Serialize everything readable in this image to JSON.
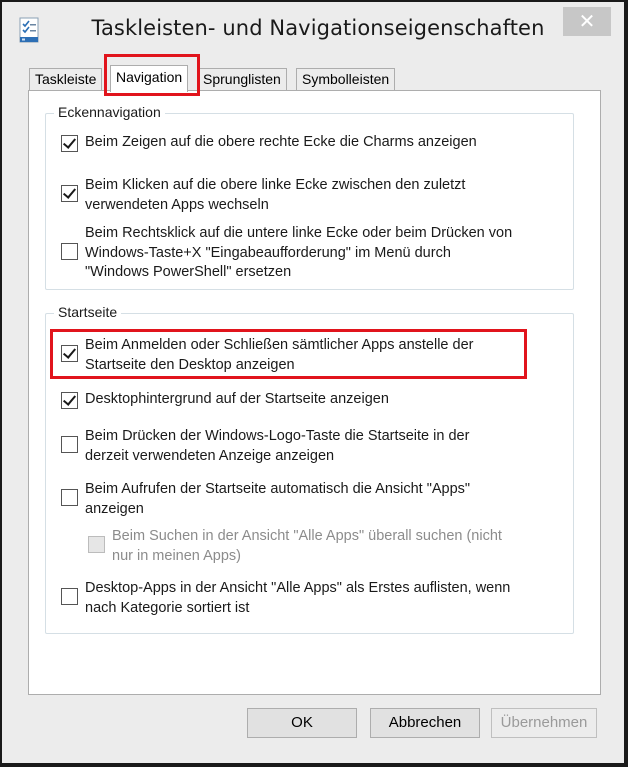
{
  "window": {
    "title": "Taskleisten- und Navigationseigenschaften",
    "close_symbol": "✕"
  },
  "tabs": [
    {
      "label": "Taskleiste",
      "active": false
    },
    {
      "label": "Navigation",
      "active": true
    },
    {
      "label": "Sprunglisten",
      "active": false
    },
    {
      "label": "Symbolleisten",
      "active": false
    }
  ],
  "groups": {
    "corner": {
      "title": "Eckennavigation",
      "items": [
        {
          "lines": [
            "Beim Zeigen auf die obere rechte Ecke die Charms anzeigen"
          ],
          "checked": true,
          "disabled": false
        },
        {
          "lines": [
            "Beim Klicken auf die obere linke Ecke zwischen den zuletzt",
            "verwendeten Apps wechseln"
          ],
          "checked": true,
          "disabled": false
        },
        {
          "lines": [
            "Beim Rechtsklick auf die untere linke Ecke oder beim Drücken von",
            "Windows-Taste+X \"Eingabeaufforderung\" im Menü durch",
            "\"Windows PowerShell\" ersetzen"
          ],
          "checked": false,
          "disabled": false
        }
      ]
    },
    "start": {
      "title": "Startseite",
      "items": [
        {
          "lines": [
            "Beim Anmelden oder Schließen sämtlicher Apps anstelle der",
            "Startseite den Desktop anzeigen"
          ],
          "checked": true,
          "disabled": false
        },
        {
          "lines": [
            "Desktophintergrund auf der Startseite anzeigen"
          ],
          "checked": true,
          "disabled": false
        },
        {
          "lines": [
            "Beim Drücken der Windows-Logo-Taste die Startseite in der",
            "derzeit verwendeten Anzeige anzeigen"
          ],
          "checked": false,
          "disabled": false
        },
        {
          "lines": [
            "Beim Aufrufen der Startseite automatisch die Ansicht \"Apps\"",
            "anzeigen"
          ],
          "checked": false,
          "disabled": false
        },
        {
          "lines": [
            "Beim Suchen in der Ansicht \"Alle Apps\" überall suchen (nicht",
            "nur in meinen Apps)"
          ],
          "checked": false,
          "disabled": true
        },
        {
          "lines": [
            "Desktop-Apps in der Ansicht \"Alle Apps\" als Erstes auflisten, wenn",
            "nach Kategorie sortiert ist"
          ],
          "checked": false,
          "disabled": false
        }
      ]
    }
  },
  "buttons": {
    "ok": "OK",
    "cancel": "Abbrechen",
    "apply": "Übernehmen",
    "apply_disabled": true
  },
  "annotations": {
    "highlight_color": "#e1141c"
  },
  "icons": {
    "app": "taskbar-properties-icon",
    "close": "close-icon"
  }
}
